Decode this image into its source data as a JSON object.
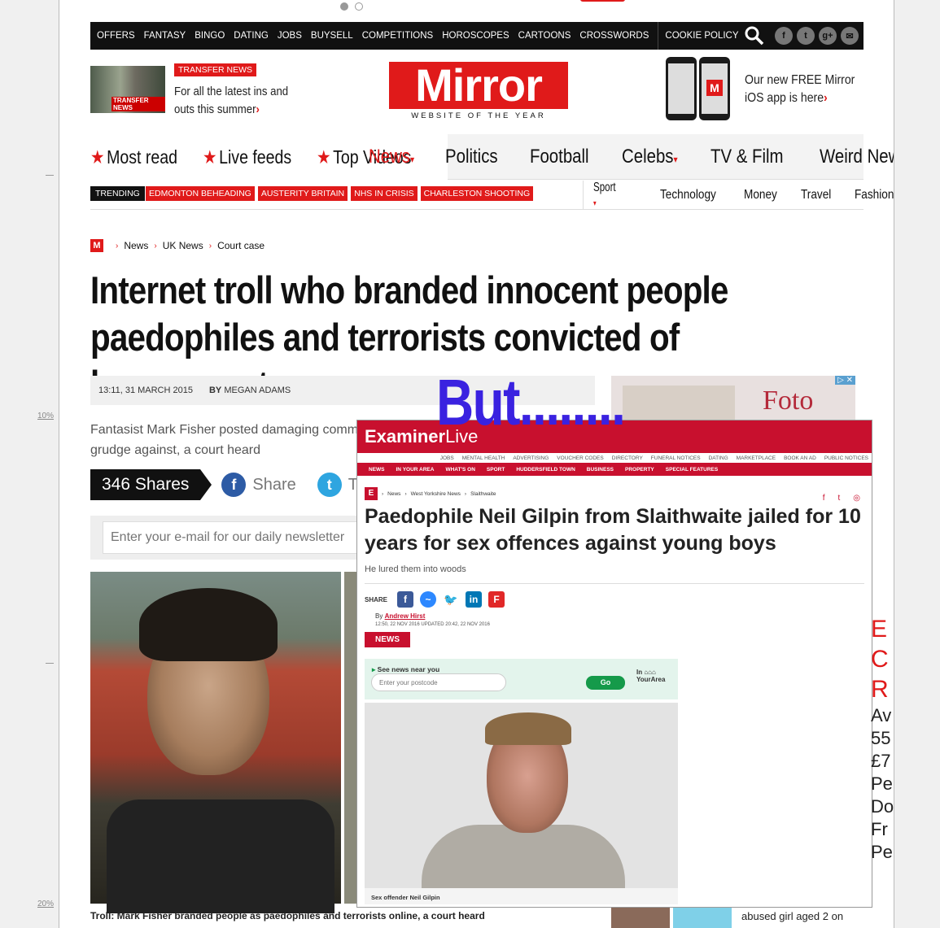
{
  "ruler": {
    "tick1": "10%",
    "tick2": "20%"
  },
  "topbar": {
    "items": [
      "OFFERS",
      "FANTASY",
      "BINGO",
      "DATING",
      "JOBS",
      "BUYSELL",
      "COMPETITIONS",
      "HOROSCOPES",
      "CARTOONS",
      "CROSSWORDS"
    ],
    "cookie": "COOKIE POLICY"
  },
  "promo": {
    "badge": "TRANSFER NEWS",
    "img_label": "TRANSFER NEWS",
    "text": "For all the latest ins and outs this summer"
  },
  "logo": {
    "name": "Mirror",
    "tagline": "WEBSITE OF THE YEAR"
  },
  "app": {
    "text": "Our new FREE Mirror iOS app is here"
  },
  "nav": {
    "left": [
      "Most read",
      "Live feeds",
      "Top Videos"
    ],
    "right": [
      "News",
      "Politics",
      "Football",
      "Celebs",
      "TV & Film",
      "Weird News"
    ]
  },
  "trending": {
    "label": "TRENDING",
    "items": [
      "EDMONTON BEHEADING",
      "AUSTERITY BRITAIN",
      "NHS IN CRISIS",
      "CHARLESTON SHOOTING"
    ],
    "subnav": [
      "Sport",
      "Technology",
      "Money",
      "Travel",
      "Fashion"
    ]
  },
  "crumbs": {
    "m": "M",
    "items": [
      "News",
      "UK News",
      "Court case"
    ]
  },
  "article": {
    "headline": "Internet troll who branded innocent people paedophiles and terrorists convicted of harassment",
    "time": "13:11, 31 MARCH 2015",
    "by": "BY",
    "author": "MEGAN ADAMS",
    "standfirst": "Fantasist Mark Fisher posted damaging comm grudge against, a court heard",
    "caption": "Troll: Mark Fisher branded people as paedophiles and terrorists online, a court heard"
  },
  "shares": {
    "count": "346 Shares",
    "share": "Share",
    "tweet": "Tweet"
  },
  "newsletter": {
    "placeholder": "Enter your e-mail for our daily newsletter"
  },
  "ad": {
    "text": "Foto"
  },
  "bottom": {
    "text": "abused girl aged 2 on"
  },
  "overlay": {
    "text": "But........"
  },
  "examiner": {
    "logo_bold": "Examiner",
    "logo_light": "Live",
    "topnav": [
      "JOBS",
      "MENTAL HEALTH",
      "ADVERTISING",
      "VOUCHER CODES",
      "DIRECTORY",
      "FUNERAL NOTICES",
      "DATING",
      "MARKETPLACE",
      "BOOK AN AD",
      "PUBLIC NOTICES"
    ],
    "secnav": [
      "NEWS",
      "IN YOUR AREA",
      "WHAT'S ON",
      "SPORT",
      "HUDDERSFIELD TOWN",
      "BUSINESS",
      "PROPERTY",
      "SPECIAL FEATURES"
    ],
    "crumbs": [
      "News",
      "West Yorkshire News",
      "Slaithwaite"
    ],
    "headline": "Paedophile Neil Gilpin from Slaithwaite jailed for 10 years for sex offences against young boys",
    "sub": "He lured them into woods",
    "share_label": "SHARE",
    "by": "By",
    "author": "Andrew Hirst",
    "dates": "12:50, 22 NOV 2016      UPDATED 20:42, 22 NOV 2016",
    "tag": "NEWS",
    "near_title": "See news near you",
    "postcode_placeholder": "Enter your postcode",
    "go": "Go",
    "your_area_top": "In",
    "your_area": "YourArea",
    "caption": "Sex offender Neil Gilpin"
  },
  "rightcol": {
    "red": [
      "E",
      "C",
      "R"
    ],
    "black": [
      "Av",
      "55",
      "£7",
      "Pe",
      "Do",
      "Fr",
      "Pe"
    ]
  }
}
